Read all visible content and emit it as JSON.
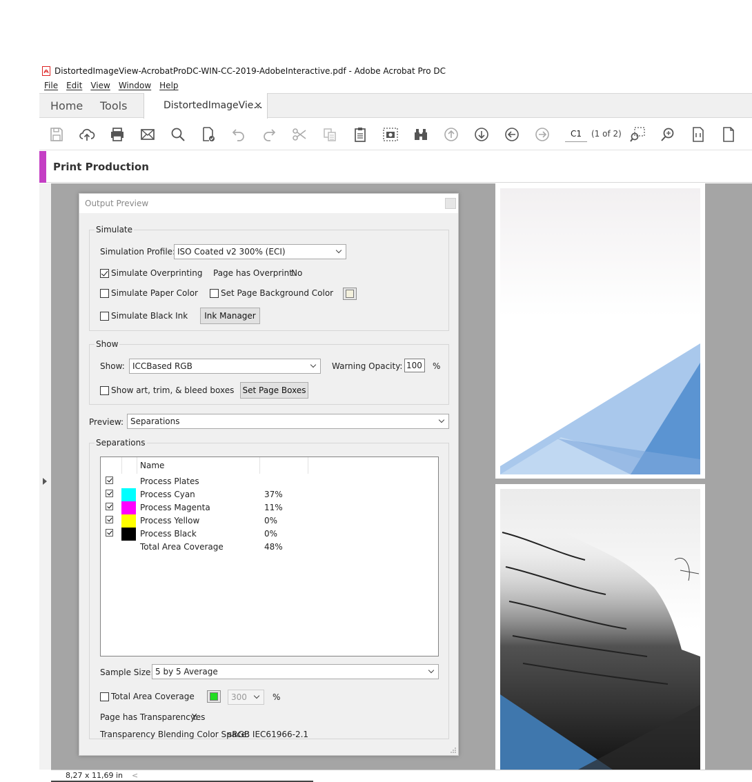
{
  "window": {
    "title": "DistortedImageView-AcrobatProDC-WIN-CC-2019-AdobeInteractive.pdf - Adobe Acrobat Pro DC"
  },
  "menu": [
    "File",
    "Edit",
    "View",
    "Window",
    "Help"
  ],
  "tabs": {
    "home": "Home",
    "tools": "Tools",
    "document": "DistortedImageVie...",
    "close": "×"
  },
  "toolbar": {
    "page_current": "C1",
    "page_count": "(1 of 2)",
    "icons": [
      "save-icon",
      "upload-cloud-icon",
      "print-icon",
      "email-icon",
      "search-icon",
      "scan-ocr-icon",
      "undo-icon",
      "redo-icon",
      "cut-icon",
      "copy-icon",
      "paste-icon",
      "snapshot-icon",
      "find-binoculars-icon",
      "prev-view-icon",
      "next-view-icon",
      "back-icon",
      "forward-icon",
      "marquee-zoom-icon",
      "zoom-icon",
      "actual-size-icon",
      "single-page-icon"
    ]
  },
  "panel": {
    "title": "Print Production",
    "accent": "#c43fc4"
  },
  "dialog": {
    "title": "Output Preview",
    "simulate": {
      "legend": "Simulate",
      "profile_label": "Simulation Profile:",
      "profile_value": "ISO Coated v2 300% (ECI)",
      "overprinting_label": "Simulate Overprinting",
      "overprinting_checked": true,
      "page_overprint_label": "Page has Overprint:",
      "page_overprint_value": "No",
      "paper_color_label": "Simulate Paper Color",
      "bg_color_label": "Set Page Background Color",
      "black_ink_label": "Simulate Black Ink",
      "ink_manager_label": "Ink Manager"
    },
    "show": {
      "legend": "Show",
      "show_label": "Show:",
      "show_value": "ICCBased RGB",
      "warning_label": "Warning Opacity:",
      "warning_value": "100",
      "percent": "%",
      "boxes_label": "Show art, trim, & bleed boxes",
      "set_boxes_label": "Set Page Boxes"
    },
    "preview": {
      "label": "Preview:",
      "value": "Separations"
    },
    "separations": {
      "legend": "Separations",
      "header_name": "Name",
      "rows": [
        {
          "checked": true,
          "color": "",
          "name": "Process Plates",
          "value": ""
        },
        {
          "checked": true,
          "color": "#00ffff",
          "name": "Process Cyan",
          "value": "37%"
        },
        {
          "checked": true,
          "color": "#ff00ff",
          "name": "Process Magenta",
          "value": "11%"
        },
        {
          "checked": true,
          "color": "#ffff00",
          "name": "Process Yellow",
          "value": "0%"
        },
        {
          "checked": true,
          "color": "#000000",
          "name": "Process Black",
          "value": "0%"
        },
        {
          "checked": false,
          "color": "",
          "name": "Total Area Coverage",
          "value": "48%",
          "no_checkbox": true
        }
      ]
    },
    "sample_size": {
      "label": "Sample Size:",
      "value": "5 by 5 Average"
    },
    "tac": {
      "label": "Total Area Coverage",
      "value": "300",
      "percent": "%",
      "swatch": "#22dd22"
    },
    "transparency": {
      "label": "Page has Transparency:",
      "value": "Yes"
    },
    "blending": {
      "label": "Transparency Blending Color Space:",
      "value": "sRGB IEC61966-2.1"
    }
  },
  "status": {
    "page_size": "8,27 x 11,69 in"
  }
}
